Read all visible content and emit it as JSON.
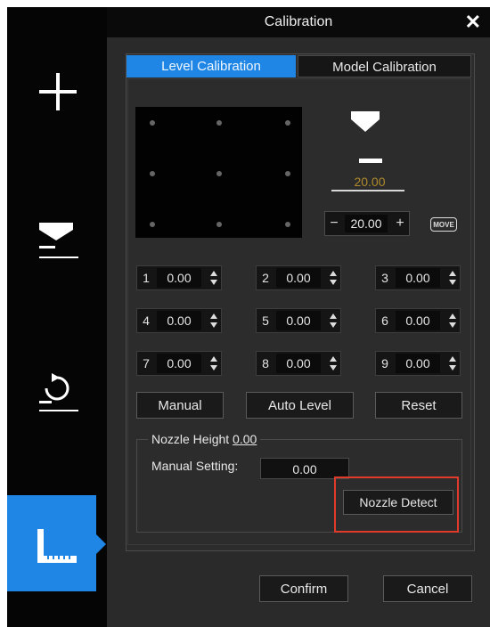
{
  "window": {
    "title": "Calibration"
  },
  "tabs": [
    {
      "label": "Level Calibration",
      "active": true
    },
    {
      "label": "Model Calibration",
      "active": false
    }
  ],
  "height_indicator": {
    "value": "20.00"
  },
  "height_stepper": {
    "minus": "−",
    "value": "20.00",
    "plus": "+"
  },
  "move_button": {
    "label": "MOVE"
  },
  "points": [
    {
      "index": "1",
      "value": "0.00"
    },
    {
      "index": "2",
      "value": "0.00"
    },
    {
      "index": "3",
      "value": "0.00"
    },
    {
      "index": "4",
      "value": "0.00"
    },
    {
      "index": "5",
      "value": "0.00"
    },
    {
      "index": "6",
      "value": "0.00"
    },
    {
      "index": "7",
      "value": "0.00"
    },
    {
      "index": "8",
      "value": "0.00"
    },
    {
      "index": "9",
      "value": "0.00"
    }
  ],
  "actions": {
    "manual": "Manual",
    "auto_level": "Auto Level",
    "reset": "Reset"
  },
  "nozzle": {
    "legend_label": "Nozzle Height",
    "legend_value": "0.00",
    "manual_label": "Manual Setting:",
    "manual_value": "0.00",
    "detect_button": "Nozzle Detect"
  },
  "footer": {
    "confirm": "Confirm",
    "cancel": "Cancel"
  },
  "sidebar": {
    "items": [
      {
        "icon": "plus-icon"
      },
      {
        "icon": "nozzle-height-icon"
      },
      {
        "icon": "rotate-reset-icon"
      },
      {
        "icon": "level-ruler-icon",
        "active": true
      }
    ]
  },
  "colors": {
    "accent": "#1f86e6",
    "highlight": "#e03a2b",
    "height_value": "#b08a2c"
  }
}
